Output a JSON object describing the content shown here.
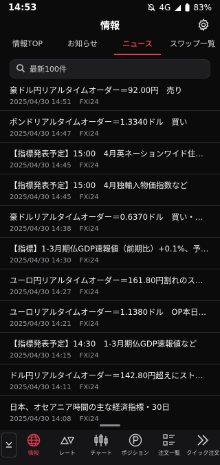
{
  "status": {
    "time": "14:53",
    "network": "4G",
    "battery": "83%"
  },
  "header": {
    "title": "情報"
  },
  "tabs": [
    {
      "label": "情報TOP"
    },
    {
      "label": "お知らせ"
    },
    {
      "label": "ニュース"
    },
    {
      "label": "スワップ一覧"
    }
  ],
  "search": {
    "placeholder": "最新100件"
  },
  "news": [
    {
      "headline": "豪ドル円リアルタイムオーダー＝92.00円　売り",
      "date": "2025/04/30 14:51",
      "source": "FXi24"
    },
    {
      "headline": "ポンドリアルタイムオーダー＝1.3340ドル　買い",
      "date": "2025/04/30 14:47",
      "source": "FXi24"
    },
    {
      "headline": "【指標発表予定】15:00　4月英ネーションワイド住宅…",
      "date": "2025/04/30 14:45",
      "source": "FXi24"
    },
    {
      "headline": "【指標発表予定】15:00　4月独輸入物価指数など",
      "date": "2025/04/30 14:45",
      "source": "FXi24"
    },
    {
      "headline": "豪ドルリアルタイムオーダー＝0.6370ドル　買い・割…",
      "date": "2025/04/30 14:38",
      "source": "FXi24"
    },
    {
      "headline": "【指標】1-3月期仏GDP速報値（前期比）+0.1%、予想…",
      "date": "2025/04/30 14:30",
      "source": "FXi24"
    },
    {
      "headline": "ユーロ円リアルタイムオーダー＝161.80円割れのスト…",
      "date": "2025/04/30 14:27",
      "source": "FXi24"
    },
    {
      "headline": "ユーロリアルタイムオーダー＝1.1380ドル　OP本日NY…",
      "date": "2025/04/30 14:21",
      "source": "FXi24"
    },
    {
      "headline": "【指標発表予定】14:30　1-3月期仏GDP速報値など",
      "date": "2025/04/30 14:15",
      "source": "FXi24"
    },
    {
      "headline": "ドル円リアルタイムオーダー＝142.80円超えにストッ…",
      "date": "2025/04/30 14:11",
      "source": "FXi24"
    },
    {
      "headline": "日本、オセアニア時間の主な経済指標・30日",
      "date": "2025/04/30 14:08",
      "source": "FXi24"
    }
  ],
  "bottom_nav": [
    {
      "label": "情報",
      "icon": "globe-icon",
      "active": true
    },
    {
      "label": "レート",
      "icon": "rate-icon"
    },
    {
      "label": "チャート",
      "icon": "candlestick-icon"
    },
    {
      "label": "ポジション",
      "icon": "position-icon"
    },
    {
      "label": "注文一覧",
      "icon": "order-list-icon"
    },
    {
      "label": "クイック注文",
      "icon": "quick-order-icon"
    }
  ],
  "colors": {
    "accent": "#e83b4f",
    "background": "#0b0b0c",
    "divider": "#2a2a2d"
  }
}
